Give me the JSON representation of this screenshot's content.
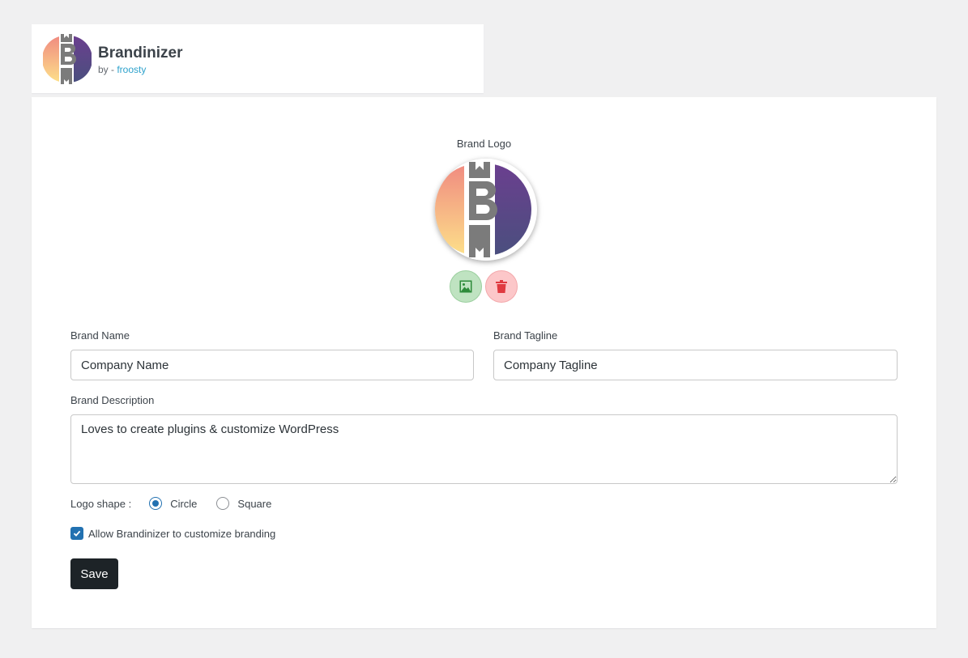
{
  "header": {
    "title": "Brandinizer",
    "by_prefix": "by - ",
    "author": "froosty"
  },
  "logo": {
    "label": "Brand Logo",
    "shape": "circle",
    "upload_icon": "image-icon",
    "delete_icon": "trash-icon"
  },
  "fields": {
    "brand_name": {
      "label": "Brand Name",
      "value": "Company Name"
    },
    "brand_tagline": {
      "label": "Brand Tagline",
      "value": "Company Tagline"
    },
    "brand_description": {
      "label": "Brand Description",
      "value": "Loves to create plugins & customize WordPress"
    }
  },
  "logo_shape": {
    "label": "Logo shape :",
    "options": [
      "Circle",
      "Square"
    ],
    "selected": "Circle"
  },
  "allow_branding": {
    "label": "Allow Brandinizer to customize branding",
    "checked": true
  },
  "save_label": "Save",
  "colors": {
    "primary": "#2271b1",
    "link": "#2ea2cc",
    "save_button": "#1d2327",
    "upload_button": "#bfe3c1",
    "delete_button": "#fcc7c9"
  }
}
